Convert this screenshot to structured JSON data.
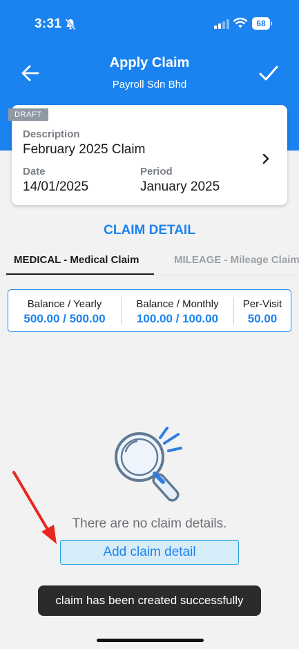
{
  "status_bar": {
    "time": "3:31",
    "battery": "68",
    "icons": [
      "bell-muted-icon",
      "signal-icon",
      "wifi-icon",
      "battery-icon"
    ]
  },
  "header": {
    "title": "Apply Claim",
    "subtitle": "Payroll Sdn Bhd",
    "back_icon": "arrow-left-icon",
    "confirm_icon": "checkmark-icon",
    "background_color": "#1a83f0"
  },
  "claim_card": {
    "badge": "DRAFT",
    "description_label": "Description",
    "description_value": "February 2025 Claim",
    "date_label": "Date",
    "date_value": "14/01/2025",
    "period_label": "Period",
    "period_value": "January 2025",
    "chevron_icon": "chevron-right-icon"
  },
  "claim_detail": {
    "section_title": "CLAIM DETAIL",
    "tabs": [
      {
        "label": "MEDICAL - Medical Claim",
        "active": true
      },
      {
        "label": "MILEAGE - Mileage Claim",
        "active": false
      }
    ],
    "balances": [
      {
        "label": "Balance / Yearly",
        "value": "500.00 / 500.00"
      },
      {
        "label": "Balance / Monthly",
        "value": "100.00 / 100.00"
      },
      {
        "label": "Per-Visit",
        "value": "50.00"
      }
    ]
  },
  "empty_state": {
    "icon": "magnifier-icon",
    "message": "There are no claim details.",
    "button_label": "Add claim detail"
  },
  "toast": {
    "message": "claim has been created successfully"
  },
  "colors": {
    "accent": "#1a83f0",
    "annotation_arrow": "#e8261f"
  }
}
